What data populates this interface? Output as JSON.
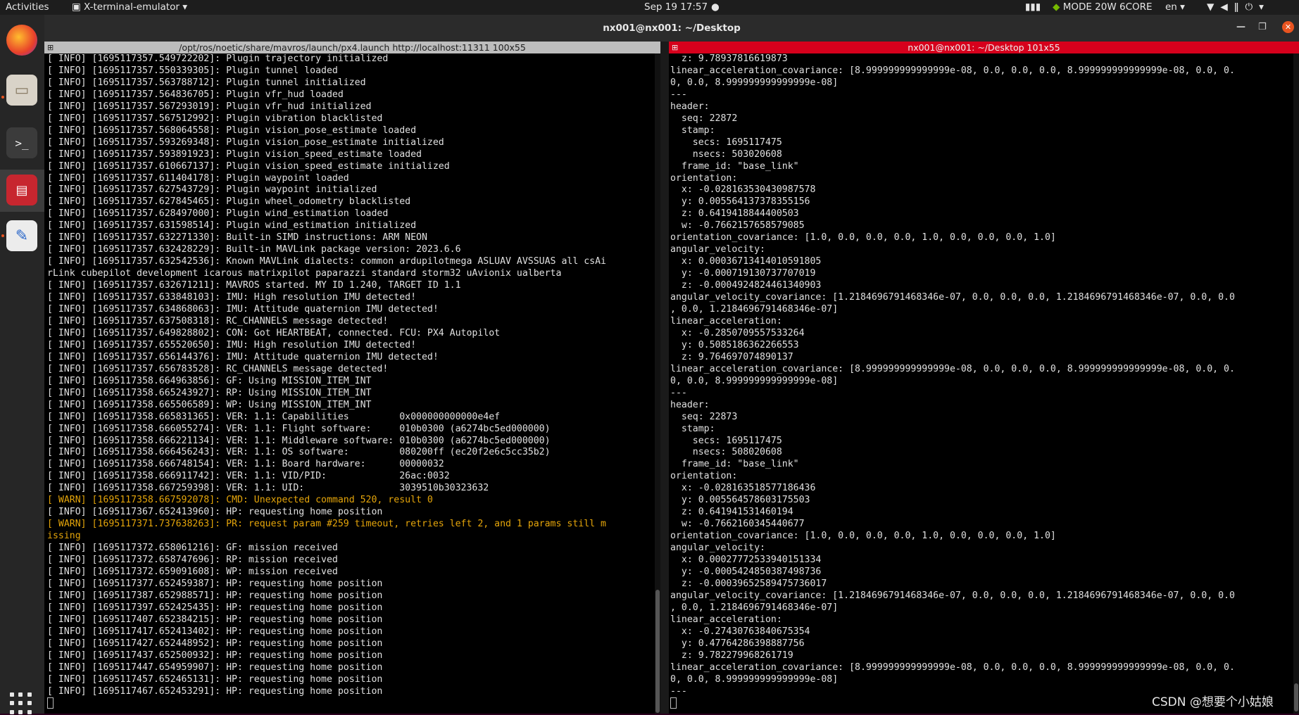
{
  "topbar": {
    "activities": "Activities",
    "app_menu": "X-terminal-emulator ▾",
    "clock": "Sep 19  17:57",
    "gpu_mode": "MODE 20W 6CORE",
    "language": "en ▾"
  },
  "window": {
    "title": "nx001@nx001: ~/Desktop"
  },
  "left_pane": {
    "title": "/opt/ros/noetic/share/mavros/launch/px4.launch http://localhost:11311 100x55",
    "lines": [
      "[ INFO] [1695117357.549722202]: Plugin trajectory initialized",
      "[ INFO] [1695117357.550339305]: Plugin tunnel loaded",
      "[ INFO] [1695117357.563788712]: Plugin tunnel initialized",
      "[ INFO] [1695117357.564836705]: Plugin vfr_hud loaded",
      "[ INFO] [1695117357.567293019]: Plugin vfr_hud initialized",
      "[ INFO] [1695117357.567512992]: Plugin vibration blacklisted",
      "[ INFO] [1695117357.568064558]: Plugin vision_pose_estimate loaded",
      "[ INFO] [1695117357.593269348]: Plugin vision_pose_estimate initialized",
      "[ INFO] [1695117357.593891923]: Plugin vision_speed_estimate loaded",
      "[ INFO] [1695117357.610667137]: Plugin vision_speed_estimate initialized",
      "[ INFO] [1695117357.611404178]: Plugin waypoint loaded",
      "[ INFO] [1695117357.627543729]: Plugin waypoint initialized",
      "[ INFO] [1695117357.627845465]: Plugin wheel_odometry blacklisted",
      "[ INFO] [1695117357.628497000]: Plugin wind_estimation loaded",
      "[ INFO] [1695117357.631598514]: Plugin wind_estimation initialized",
      "[ INFO] [1695117357.632271330]: Built-in SIMD instructions: ARM NEON",
      "[ INFO] [1695117357.632428229]: Built-in MAVLink package version: 2023.6.6",
      "[ INFO] [1695117357.632542536]: Known MAVLink dialects: common ardupilotmega ASLUAV AVSSUAS all csAi",
      "rLink cubepilot development icarous matrixpilot paparazzi standard storm32 uAvionix ualberta",
      "[ INFO] [1695117357.632671211]: MAVROS started. MY ID 1.240, TARGET ID 1.1",
      "[ INFO] [1695117357.633848103]: IMU: High resolution IMU detected!",
      "[ INFO] [1695117357.634868063]: IMU: Attitude quaternion IMU detected!",
      "[ INFO] [1695117357.637508318]: RC_CHANNELS message detected!",
      "[ INFO] [1695117357.649828802]: CON: Got HEARTBEAT, connected. FCU: PX4 Autopilot",
      "[ INFO] [1695117357.655520650]: IMU: High resolution IMU detected!",
      "[ INFO] [1695117357.656144376]: IMU: Attitude quaternion IMU detected!",
      "[ INFO] [1695117357.656783528]: RC_CHANNELS message detected!",
      "[ INFO] [1695117358.664963856]: GF: Using MISSION_ITEM_INT",
      "[ INFO] [1695117358.665243927]: RP: Using MISSION_ITEM_INT",
      "[ INFO] [1695117358.665506589]: WP: Using MISSION_ITEM_INT",
      "[ INFO] [1695117358.665831365]: VER: 1.1: Capabilities         0x000000000000e4ef",
      "[ INFO] [1695117358.666055274]: VER: 1.1: Flight software:     010b0300 (a6274bc5ed000000)",
      "[ INFO] [1695117358.666221134]: VER: 1.1: Middleware software: 010b0300 (a6274bc5ed000000)",
      "[ INFO] [1695117358.666456243]: VER: 1.1: OS software:         080200ff (ec20f2e6c5cc35b2)",
      "[ INFO] [1695117358.666748154]: VER: 1.1: Board hardware:      00000032",
      "[ INFO] [1695117358.666911742]: VER: 1.1: VID/PID:             26ac:0032",
      "[ INFO] [1695117358.667259398]: VER: 1.1: UID:                 3039510b30323632",
      "[ WARN] [1695117358.667592078]: CMD: Unexpected command 520, result 0",
      "[ INFO] [1695117367.652413960]: HP: requesting home position",
      "[ WARN] [1695117371.737638263]: PR: request param #259 timeout, retries left 2, and 1 params still m",
      "issing",
      "[ INFO] [1695117372.658061216]: GF: mission received",
      "[ INFO] [1695117372.658747696]: RP: mission received",
      "[ INFO] [1695117372.659091608]: WP: mission received",
      "[ INFO] [1695117377.652459387]: HP: requesting home position",
      "[ INFO] [1695117387.652988571]: HP: requesting home position",
      "[ INFO] [1695117397.652425435]: HP: requesting home position",
      "[ INFO] [1695117407.652384215]: HP: requesting home position",
      "[ INFO] [1695117417.652413402]: HP: requesting home position",
      "[ INFO] [1695117427.652448952]: HP: requesting home position",
      "[ INFO] [1695117437.652500932]: HP: requesting home position",
      "[ INFO] [1695117447.654959907]: HP: requesting home position",
      "[ INFO] [1695117457.652465131]: HP: requesting home position",
      "[ INFO] [1695117467.652453291]: HP: requesting home position"
    ]
  },
  "right_pane": {
    "title": "nx001@nx001: ~/Desktop 101x55",
    "lines": [
      "  z: 9.78937816619873",
      "linear_acceleration_covariance: [8.999999999999999e-08, 0.0, 0.0, 0.0, 8.999999999999999e-08, 0.0, 0.",
      "0, 0.0, 8.999999999999999e-08]",
      "---",
      "header:",
      "  seq: 22872",
      "  stamp:",
      "    secs: 1695117475",
      "    nsecs: 503020608",
      "  frame_id: \"base_link\"",
      "orientation:",
      "  x: -0.028163530430987578",
      "  y: 0.005564137378355156",
      "  z: 0.6419418844400503",
      "  w: -0.7662157658579085",
      "orientation_covariance: [1.0, 0.0, 0.0, 0.0, 1.0, 0.0, 0.0, 0.0, 1.0]",
      "angular_velocity:",
      "  x: 0.00036713414010591805",
      "  y: -0.000719130737707019",
      "  z: -0.0004924824461340903",
      "angular_velocity_covariance: [1.2184696791468346e-07, 0.0, 0.0, 0.0, 1.2184696791468346e-07, 0.0, 0.0",
      ", 0.0, 1.2184696791468346e-07]",
      "linear_acceleration:",
      "  x: -0.2850709557533264",
      "  y: 0.5085186362266553",
      "  z: 9.764697074890137",
      "linear_acceleration_covariance: [8.999999999999999e-08, 0.0, 0.0, 0.0, 8.999999999999999e-08, 0.0, 0.",
      "0, 0.0, 8.999999999999999e-08]",
      "---",
      "header:",
      "  seq: 22873",
      "  stamp:",
      "    secs: 1695117475",
      "    nsecs: 508020608",
      "  frame_id: \"base_link\"",
      "orientation:",
      "  x: -0.028163518577186436",
      "  y: 0.005564578603175503",
      "  z: 0.641941531460194",
      "  w: -0.7662160345440677",
      "orientation_covariance: [1.0, 0.0, 0.0, 0.0, 1.0, 0.0, 0.0, 0.0, 1.0]",
      "angular_velocity:",
      "  x: 0.00027772533940151334",
      "  y: -0.0005424850387498736",
      "  z: -0.00039652589475736017",
      "angular_velocity_covariance: [1.2184696791468346e-07, 0.0, 0.0, 0.0, 1.2184696791468346e-07, 0.0, 0.0",
      ", 0.0, 1.2184696791468346e-07]",
      "linear_acceleration:",
      "  x: -0.27430763840675354",
      "  y: 0.47764286398887756",
      "  z: 9.782279968261719",
      "linear_acceleration_covariance: [8.999999999999999e-08, 0.0, 0.0, 0.0, 8.999999999999999e-08, 0.0, 0.",
      "0, 0.0, 8.999999999999999e-08]",
      "---"
    ]
  },
  "watermark": "CSDN @想要个小姑娘",
  "colors": {
    "accent": "#e95420",
    "warn": "#e5a50a",
    "right_title_bg": "#d6001c"
  }
}
